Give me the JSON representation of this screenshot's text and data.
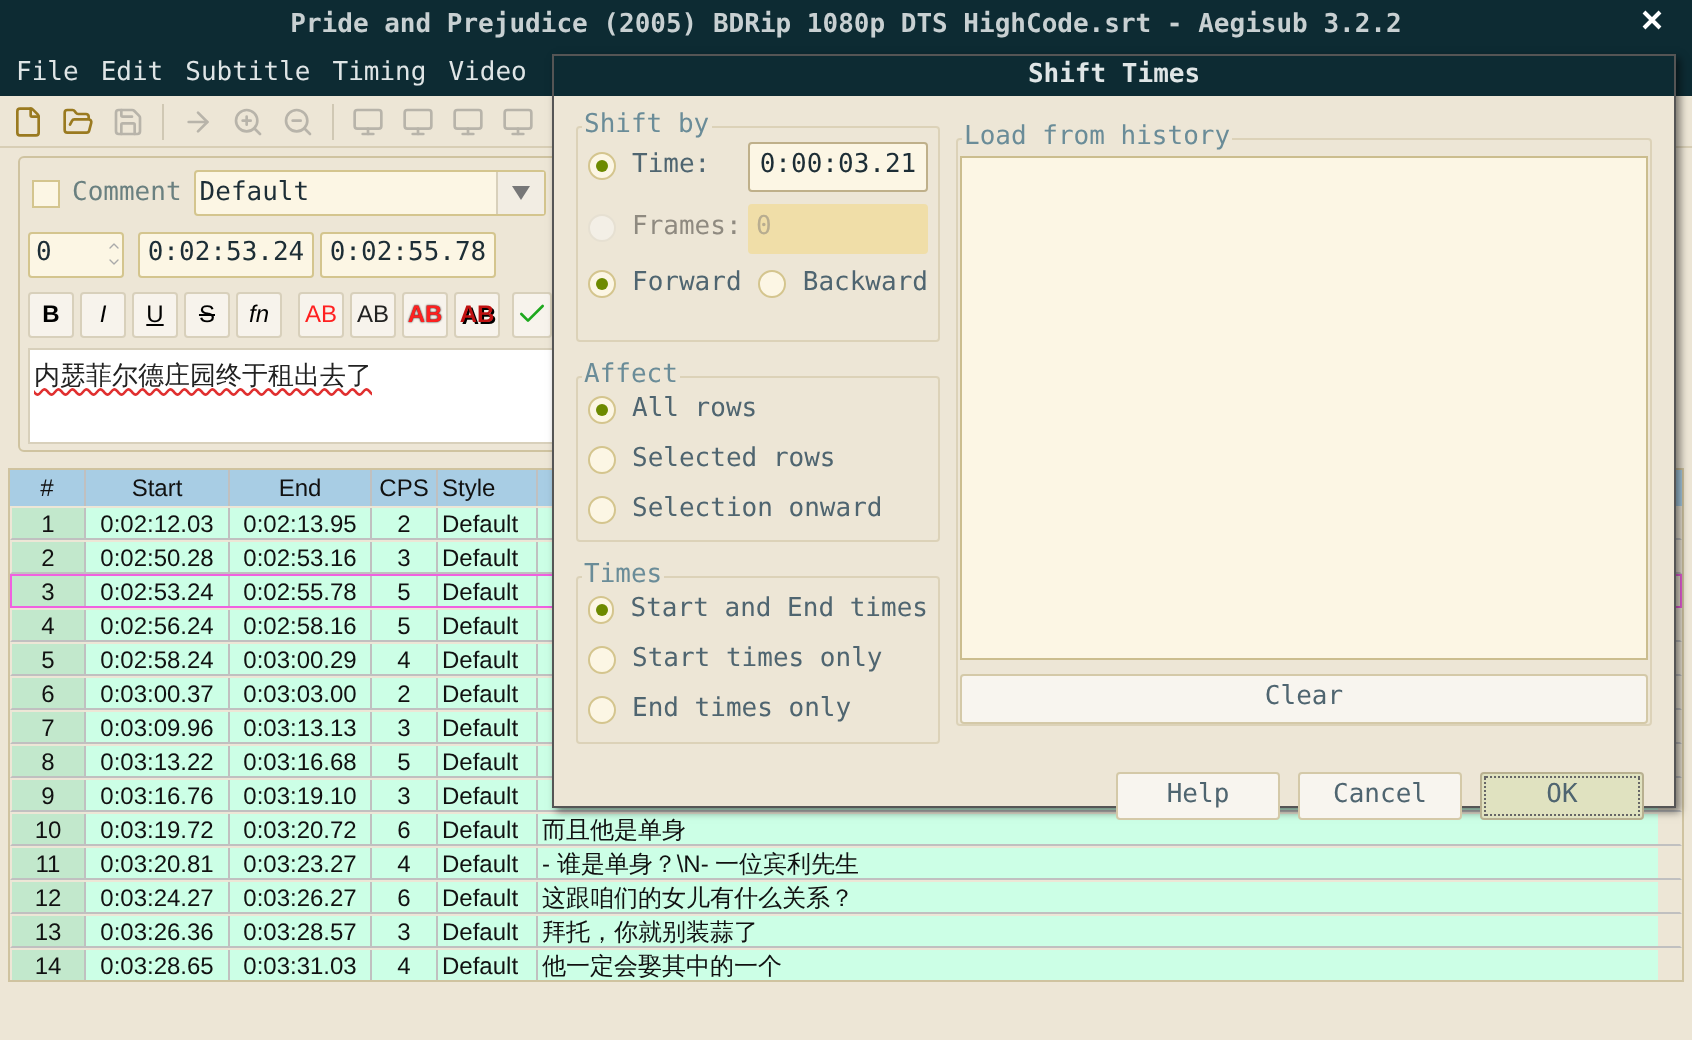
{
  "window": {
    "title": "Pride and Prejudice (2005) BDRip 1080p DTS HighCode.srt - Aegisub 3.2.2"
  },
  "menu": [
    "File",
    "Edit",
    "Subtitle",
    "Timing",
    "Video"
  ],
  "editor": {
    "comment": {
      "label": "Comment",
      "checked": false
    },
    "style": "Default",
    "layer": "0",
    "start": "0:02:53.24",
    "end": "0:02:55.78",
    "format_buttons": [
      {
        "kind": "bold",
        "label": "B"
      },
      {
        "kind": "italic",
        "label": "I"
      },
      {
        "kind": "underline",
        "label": "U"
      },
      {
        "kind": "strike",
        "label": "S"
      },
      {
        "kind": "font",
        "label": "fn"
      },
      {
        "kind": "primary",
        "label": "AB"
      },
      {
        "kind": "secondary",
        "label": "AB"
      },
      {
        "kind": "outline",
        "label": "AB"
      },
      {
        "kind": "shadow",
        "label": "AB"
      }
    ],
    "text": "内瑟菲尔德庄园终于租出去了"
  },
  "grid": {
    "columns": [
      "#",
      "Start",
      "End",
      "CPS",
      "Style"
    ],
    "rows": [
      {
        "num": "1",
        "start": "0:02:12.03",
        "end": "0:02:13.95",
        "cps": "2",
        "style": "Default",
        "selected": false
      },
      {
        "num": "2",
        "start": "0:02:50.28",
        "end": "0:02:53.16",
        "cps": "3",
        "style": "Default",
        "selected": false
      },
      {
        "num": "3",
        "start": "0:02:53.24",
        "end": "0:02:55.78",
        "cps": "5",
        "style": "Default",
        "selected": true
      },
      {
        "num": "4",
        "start": "0:02:56.24",
        "end": "0:02:58.16",
        "cps": "5",
        "style": "Default",
        "selected": false
      },
      {
        "num": "5",
        "start": "0:02:58.24",
        "end": "0:03:00.29",
        "cps": "4",
        "style": "Default",
        "selected": false
      },
      {
        "num": "6",
        "start": "0:03:00.37",
        "end": "0:03:03.00",
        "cps": "2",
        "style": "Default",
        "selected": false
      },
      {
        "num": "7",
        "start": "0:03:09.96",
        "end": "0:03:13.13",
        "cps": "3",
        "style": "Default",
        "selected": false
      },
      {
        "num": "8",
        "start": "0:03:13.22",
        "end": "0:03:16.68",
        "cps": "5",
        "style": "Default",
        "selected": false
      },
      {
        "num": "9",
        "start": "0:03:16.76",
        "end": "0:03:19.10",
        "cps": "3",
        "style": "Default",
        "selected": false
      },
      {
        "num": "10",
        "start": "0:03:19.72",
        "end": "0:03:20.72",
        "cps": "6",
        "style": "Default",
        "text": "而且他是单身",
        "selected": false
      },
      {
        "num": "11",
        "start": "0:03:20.81",
        "end": "0:03:23.27",
        "cps": "4",
        "style": "Default",
        "text": "- 谁是单身？\\N- 一位宾利先生",
        "selected": false
      },
      {
        "num": "12",
        "start": "0:03:24.27",
        "end": "0:03:26.27",
        "cps": "6",
        "style": "Default",
        "text": "这跟咱们的女儿有什么关系？",
        "selected": false
      },
      {
        "num": "13",
        "start": "0:03:26.36",
        "end": "0:03:28.57",
        "cps": "3",
        "style": "Default",
        "text": "拜托，你就别装蒜了",
        "selected": false
      },
      {
        "num": "14",
        "start": "0:03:28.65",
        "end": "0:03:31.03",
        "cps": "4",
        "style": "Default",
        "text": "他一定会娶其中的一个",
        "selected": false
      }
    ]
  },
  "dialog": {
    "title": "Shift Times",
    "shift_by": {
      "label": "Shift by",
      "modes": [
        {
          "label": "Time:",
          "selected": true,
          "disabled": false,
          "value": "0:00:03.21"
        },
        {
          "label": "Frames:",
          "selected": false,
          "disabled": true,
          "value": "0"
        }
      ],
      "direction": [
        {
          "label": "Forward",
          "selected": true
        },
        {
          "label": "Backward",
          "selected": false
        }
      ]
    },
    "affect": {
      "label": "Affect",
      "options": [
        {
          "label": "All rows",
          "selected": true
        },
        {
          "label": "Selected rows",
          "selected": false
        },
        {
          "label": "Selection onward",
          "selected": false
        }
      ]
    },
    "times": {
      "label": "Times",
      "options": [
        {
          "label": "Start and End times",
          "selected": true
        },
        {
          "label": "Start times only",
          "selected": false
        },
        {
          "label": "End times only",
          "selected": false
        }
      ]
    },
    "history": {
      "label": "Load from history",
      "clear": "Clear"
    },
    "buttons": [
      {
        "label": "Help",
        "default": false
      },
      {
        "label": "Cancel",
        "default": false
      },
      {
        "label": "OK",
        "default": true
      }
    ]
  }
}
